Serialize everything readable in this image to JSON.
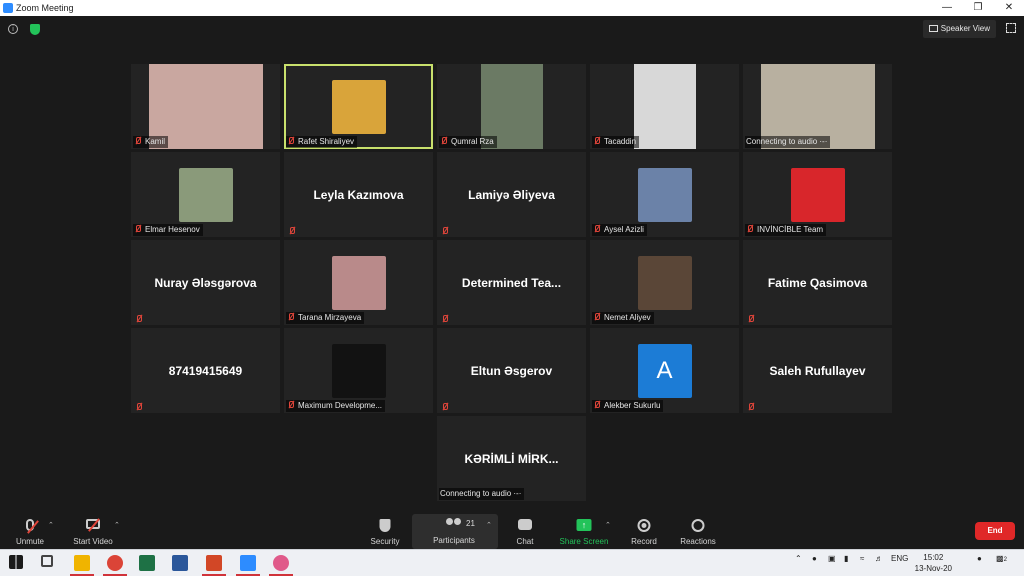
{
  "window": {
    "title": "Zoom Meeting"
  },
  "topbar": {
    "speaker_view_label": "Speaker View"
  },
  "tiles": [
    {
      "name": "Kamil",
      "show": "label",
      "photo": "#c9a7a0"
    },
    {
      "name": "Rafet Shiraliyev",
      "show": "label",
      "photo": "#d9a43a",
      "active": true
    },
    {
      "name": "Qumral Rza",
      "show": "label",
      "photo": "#6b7a64"
    },
    {
      "name": "Tacaddin",
      "show": "label",
      "photo": "#d8d8d8"
    },
    {
      "name": "Connecting to audio ·-·",
      "show": "label",
      "photo": "#b8b0a0",
      "nomute": true
    },
    {
      "name": "Elmar Hesenov",
      "show": "label",
      "photo": "#8a9a7a"
    },
    {
      "name": "Leyla Kazımova",
      "show": "name"
    },
    {
      "name": "Lamiyə Əliyeva",
      "show": "name"
    },
    {
      "name": "Aysel Azizli",
      "show": "label",
      "photo": "#6b82a8"
    },
    {
      "name": "INVİNCİBLE Team",
      "show": "label",
      "photo": "#d8262b"
    },
    {
      "name": "Nuray Ələsgərova",
      "show": "name"
    },
    {
      "name": "Tarana Mirzayeva",
      "show": "label",
      "photo": "#b98a8a"
    },
    {
      "name": "Determined  Tea...",
      "show": "name"
    },
    {
      "name": "Nemet Aliyev",
      "show": "label",
      "photo": "#5a4637"
    },
    {
      "name": "Fatime Qasimova",
      "show": "name"
    },
    {
      "name": "87419415649",
      "show": "name"
    },
    {
      "name": "Maximum Developme...",
      "show": "label",
      "photo": "#121212"
    },
    {
      "name": "Eltun Əsgerov",
      "show": "name"
    },
    {
      "name": "Alekber Sukurlu",
      "show": "label",
      "photo": "#1c7cd6",
      "letter": "A"
    },
    {
      "name": "Saleh Rufullayev",
      "show": "name"
    },
    {
      "name": "KƏRİMLİ  MİRK...",
      "show": "name",
      "caption": "Connecting to audio ·-·"
    }
  ],
  "toolbar": {
    "unmute": "Unmute",
    "start_video": "Start Video",
    "security": "Security",
    "participants": "Participants",
    "participant_count": "21",
    "chat": "Chat",
    "share_screen": "Share Screen",
    "record": "Record",
    "reactions": "Reactions",
    "end": "End"
  },
  "taskbar": {
    "lang": "ENG",
    "time": "15:02",
    "date": "13-Nov-20",
    "notif_count": "2"
  },
  "colors": {
    "accent_green": "#23c35a",
    "end_red": "#e02828",
    "active_border": "#c8e06c",
    "zoom_blue": "#2d8cff"
  }
}
